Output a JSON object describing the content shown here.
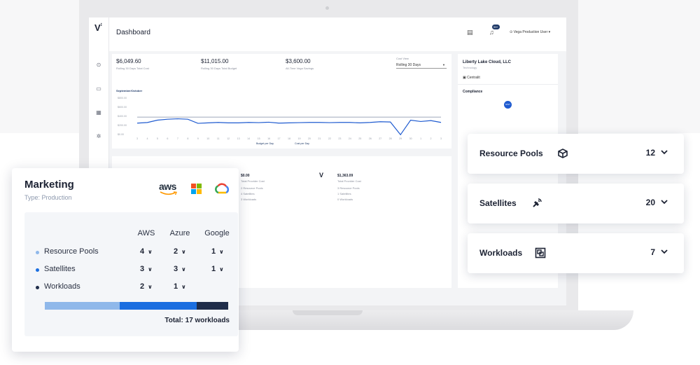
{
  "dashboard": {
    "title": "Dashboard",
    "user": "Vega Production User",
    "notification_badge": "99+",
    "stats": [
      {
        "value": "$6,049.60",
        "label": "Rolling 30 Days Total Cost"
      },
      {
        "value": "$11,015.00",
        "label": "Rolling 30 Days Total Budget"
      },
      {
        "value": "$3,600.00",
        "label": "All-Time Vega Savings"
      }
    ],
    "cost_view": {
      "label": "Cost View",
      "selected": "Rolling 30 Days"
    },
    "chart_title": "September/October",
    "legend": {
      "budget": "Budget per Day",
      "cost": "Cost per Day"
    },
    "providers": [
      {
        "value": "$0.00",
        "label": "Total Provider Cost",
        "pools": "2 Resource Pools",
        "sats": "4 Satellites",
        "wls": "3 Workloads"
      },
      {
        "value": "$1,363.09",
        "label": "Total Provider Cost",
        "pools": "3 Resource Pools",
        "sats": "1 Satellites",
        "wls": "0 Workloads"
      }
    ],
    "org": {
      "name": "Liberty Lake Cloud, LLC",
      "sub": "Technology",
      "centralit": "Centralit",
      "compliance": "Compliance",
      "badge": "NIST"
    }
  },
  "chart_data": {
    "type": "line",
    "title": "September/October",
    "x": [
      "3",
      "4",
      "5",
      "6",
      "7",
      "8",
      "9",
      "10",
      "11",
      "12",
      "13",
      "14",
      "15",
      "16",
      "17",
      "18",
      "19",
      "20",
      "21",
      "22",
      "23",
      "24",
      "25",
      "26",
      "27",
      "28",
      "29",
      "30",
      "1",
      "2",
      "3"
    ],
    "y_ticks": [
      "$800.00",
      "$600.00",
      "$400.00",
      "$200.00",
      "$0.00"
    ],
    "ylim": [
      0,
      800
    ],
    "series": [
      {
        "name": "Budget per Day",
        "values": [
          367,
          367,
          367,
          367,
          367,
          367,
          367,
          367,
          367,
          367,
          367,
          367,
          367,
          367,
          367,
          367,
          367,
          367,
          367,
          367,
          367,
          367,
          367,
          367,
          367,
          367,
          367,
          367,
          367,
          367,
          367
        ]
      },
      {
        "name": "Cost per Day",
        "values": [
          235,
          248,
          300,
          320,
          330,
          320,
          230,
          240,
          250,
          240,
          240,
          250,
          245,
          255,
          235,
          240,
          245,
          250,
          250,
          245,
          250,
          250,
          240,
          250,
          265,
          260,
          -20,
          300,
          270,
          290,
          250
        ]
      }
    ],
    "grid": false,
    "legend_position": "bottom"
  },
  "summary_cards": [
    {
      "label": "Resource Pools",
      "count": "12",
      "icon": "resource-pools-icon"
    },
    {
      "label": "Satellites",
      "count": "20",
      "icon": "satellite-icon"
    },
    {
      "label": "Workloads",
      "count": "7",
      "icon": "workloads-icon"
    }
  ],
  "marketing": {
    "title": "Marketing",
    "type": "Type: Production",
    "columns": [
      "AWS",
      "Azure",
      "Google"
    ],
    "rows": [
      {
        "label": "Resource Pools",
        "values": [
          "4",
          "2",
          "1"
        ],
        "color": "#8fb8ea"
      },
      {
        "label": "Satellites",
        "values": [
          "3",
          "3",
          "1"
        ],
        "color": "#1a6ee0"
      },
      {
        "label": "Workloads",
        "values": [
          "2",
          "1",
          ""
        ],
        "color": "#1f2d4a"
      }
    ],
    "bar_share": [
      0.41,
      0.42,
      0.17
    ],
    "total": "Total: 17 workloads",
    "logo_aws": "aws"
  }
}
